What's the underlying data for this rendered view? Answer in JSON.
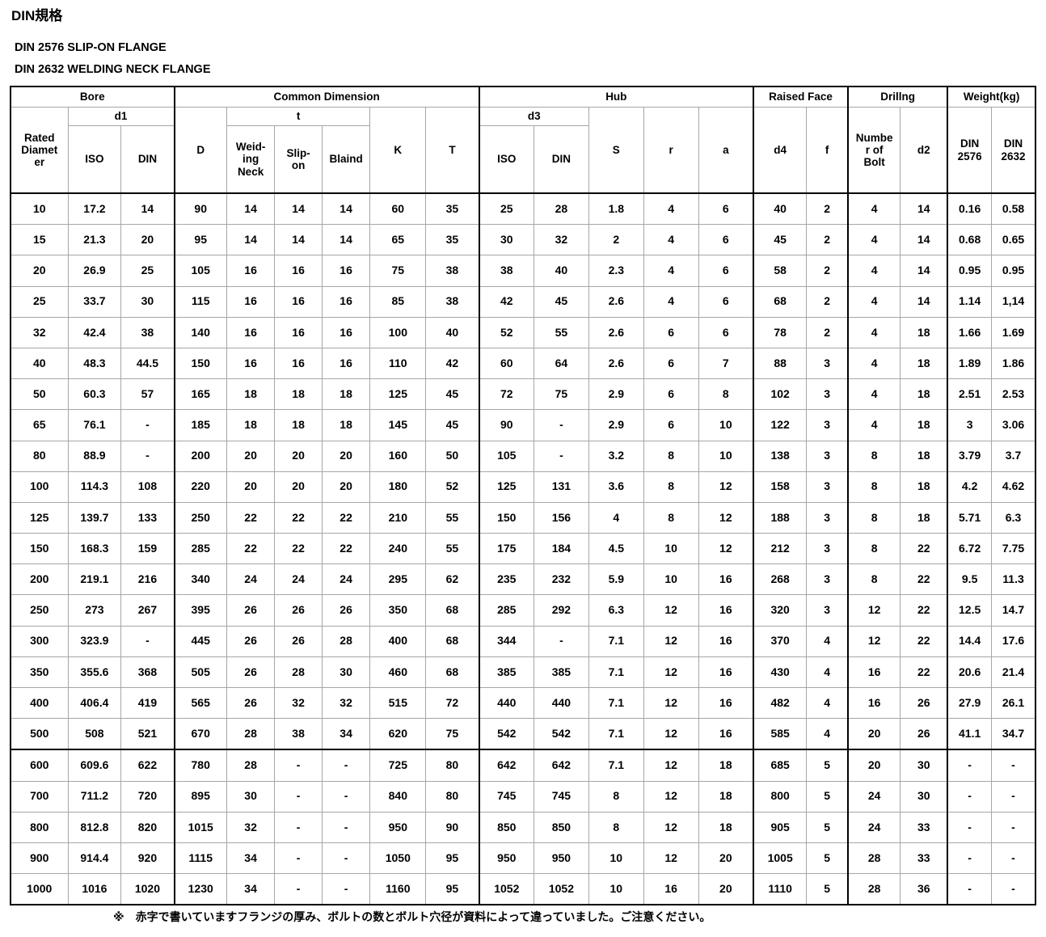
{
  "titles": {
    "main": "DIN規格",
    "sub1": "DIN 2576 SLIP-ON FLANGE",
    "sub2": "DIN 2632 WELDING NECK FLANGE"
  },
  "footnote": {
    "mark": "※",
    "text": "赤字で書いていますフランジの厚み、ボルトの数とボルト穴径が資料によって違っていました。ご注意ください。"
  },
  "colors": {
    "highlight": "#ff0000",
    "text": "#000000",
    "grid": "#a6a6a6",
    "frame": "#000000"
  },
  "table": {
    "groups": [
      {
        "label": "Bore",
        "span": 3
      },
      {
        "label": "Common Dimension",
        "span": 6
      },
      {
        "label": "Hub",
        "span": 5
      },
      {
        "label": "Raised Face",
        "span": 2
      },
      {
        "label": "Drillng",
        "span": 2
      },
      {
        "label": "Weight(kg)",
        "span": 2
      }
    ],
    "subgroups": {
      "d1": "d1",
      "t": "t",
      "d3": "d3"
    },
    "columns": [
      "Rated Diameter",
      "ISO",
      "DIN",
      "D",
      "Weid-ing Neck",
      "Slip-on",
      "Blaind",
      "K",
      "T",
      "ISO",
      "DIN",
      "S",
      "r",
      "a",
      "d4",
      "f",
      "Number of Bolt",
      "d2",
      "DIN 2576",
      "DIN 2632"
    ],
    "column_lines": {
      "rated_diameter": [
        "Rated",
        "Diamet",
        "er"
      ],
      "welding_neck": [
        "Weid-",
        "ing",
        "Neck"
      ],
      "slip_on": [
        "Slip-",
        "on"
      ],
      "number_of_bolt": [
        "Numbe",
        "r of",
        "Bolt"
      ],
      "din_2576": [
        "DIN",
        "2576"
      ],
      "din_2632": [
        "DIN",
        "2632"
      ]
    },
    "rows": [
      {
        "cells": [
          "10",
          "17.2",
          "14",
          "90",
          "14",
          "14",
          "14",
          "60",
          "35",
          "25",
          "28",
          "1.8",
          "4",
          "6",
          "40",
          "2",
          "4",
          "14",
          "0.16",
          "0.58"
        ],
        "red": []
      },
      {
        "cells": [
          "15",
          "21.3",
          "20",
          "95",
          "14",
          "14",
          "14",
          "65",
          "35",
          "30",
          "32",
          "2",
          "4",
          "6",
          "45",
          "2",
          "4",
          "14",
          "0.68",
          "0.65"
        ],
        "red": []
      },
      {
        "cells": [
          "20",
          "26.9",
          "25",
          "105",
          "16",
          "16",
          "16",
          "75",
          "38",
          "38",
          "40",
          "2.3",
          "4",
          "6",
          "58",
          "2",
          "4",
          "14",
          "0.95",
          "0.95"
        ],
        "red": []
      },
      {
        "cells": [
          "25",
          "33.7",
          "30",
          "115",
          "16",
          "16",
          "16",
          "85",
          "38",
          "42",
          "45",
          "2.6",
          "4",
          "6",
          "68",
          "2",
          "4",
          "14",
          "1.14",
          "1,14"
        ],
        "red": []
      },
      {
        "cells": [
          "32",
          "42.4",
          "38",
          "140",
          "16",
          "16",
          "16",
          "100",
          "40",
          "52",
          "55",
          "2.6",
          "6",
          "6",
          "78",
          "2",
          "4",
          "18",
          "1.66",
          "1.69"
        ],
        "red": []
      },
      {
        "cells": [
          "40",
          "48.3",
          "44.5",
          "150",
          "16",
          "16",
          "16",
          "110",
          "42",
          "60",
          "64",
          "2.6",
          "6",
          "7",
          "88",
          "3",
          "4",
          "18",
          "1.89",
          "1.86"
        ],
        "red": []
      },
      {
        "cells": [
          "50",
          "60.3",
          "57",
          "165",
          "18",
          "18",
          "18",
          "125",
          "45",
          "72",
          "75",
          "2.9",
          "6",
          "8",
          "102",
          "3",
          "4",
          "18",
          "2.51",
          "2.53"
        ],
        "red": []
      },
      {
        "cells": [
          "65",
          "76.1",
          "-",
          "185",
          "18",
          "18",
          "18",
          "145",
          "45",
          "90",
          "-",
          "2.9",
          "6",
          "10",
          "122",
          "3",
          "4",
          "18",
          "3",
          "3.06"
        ],
        "red": []
      },
      {
        "cells": [
          "80",
          "88.9",
          "-",
          "200",
          "20",
          "20",
          "20",
          "160",
          "50",
          "105",
          "-",
          "3.2",
          "8",
          "10",
          "138",
          "3",
          "8",
          "18",
          "3.79",
          "3.7"
        ],
        "red": [
          16
        ]
      },
      {
        "cells": [
          "100",
          "114.3",
          "108",
          "220",
          "20",
          "20",
          "20",
          "180",
          "52",
          "125",
          "131",
          "3.6",
          "8",
          "12",
          "158",
          "3",
          "8",
          "18",
          "4.2",
          "4.62"
        ],
        "red": []
      },
      {
        "cells": [
          "125",
          "139.7",
          "133",
          "250",
          "22",
          "22",
          "22",
          "210",
          "55",
          "150",
          "156",
          "4",
          "8",
          "12",
          "188",
          "3",
          "8",
          "18",
          "5.71",
          "6.3"
        ],
        "red": []
      },
      {
        "cells": [
          "150",
          "168.3",
          "159",
          "285",
          "22",
          "22",
          "22",
          "240",
          "55",
          "175",
          "184",
          "4.5",
          "10",
          "12",
          "212",
          "3",
          "8",
          "22",
          "6.72",
          "7.75"
        ],
        "red": [
          17
        ]
      },
      {
        "cells": [
          "200",
          "219.1",
          "216",
          "340",
          "24",
          "24",
          "24",
          "295",
          "62",
          "235",
          "232",
          "5.9",
          "10",
          "16",
          "268",
          "3",
          "8",
          "22",
          "9.5",
          "11.3"
        ],
        "red": [
          17
        ]
      },
      {
        "cells": [
          "250",
          "273",
          "267",
          "395",
          "26",
          "26",
          "26",
          "350",
          "68",
          "285",
          "292",
          "6.3",
          "12",
          "16",
          "320",
          "3",
          "12",
          "22",
          "12.5",
          "14.7"
        ],
        "red": [
          17
        ]
      },
      {
        "cells": [
          "300",
          "323.9",
          "-",
          "445",
          "26",
          "26",
          "28",
          "400",
          "68",
          "344",
          "-",
          "7.1",
          "12",
          "16",
          "370",
          "4",
          "12",
          "22",
          "14.4",
          "17.6"
        ],
        "red": [
          17
        ]
      },
      {
        "cells": [
          "350",
          "355.6",
          "368",
          "505",
          "26",
          "28",
          "30",
          "460",
          "68",
          "385",
          "385",
          "7.1",
          "12",
          "16",
          "430",
          "4",
          "16",
          "22",
          "20.6",
          "21.4"
        ],
        "red": [
          17
        ]
      },
      {
        "cells": [
          "400",
          "406.4",
          "419",
          "565",
          "26",
          "32",
          "32",
          "515",
          "72",
          "440",
          "440",
          "7.1",
          "12",
          "16",
          "482",
          "4",
          "16",
          "26",
          "27.9",
          "26.1"
        ],
        "red": [
          17
        ]
      },
      {
        "cells": [
          "500",
          "508",
          "521",
          "670",
          "28",
          "38",
          "34",
          "620",
          "75",
          "542",
          "542",
          "7.1",
          "12",
          "16",
          "585",
          "4",
          "20",
          "26",
          "41.1",
          "34.7"
        ],
        "red": [
          6,
          17
        ]
      },
      {
        "cells": [
          "600",
          "609.6",
          "622",
          "780",
          "28",
          "-",
          "-",
          "725",
          "80",
          "642",
          "642",
          "7.1",
          "12",
          "18",
          "685",
          "5",
          "20",
          "30",
          "-",
          "-"
        ],
        "red": []
      },
      {
        "cells": [
          "700",
          "711.2",
          "720",
          "895",
          "30",
          "-",
          "-",
          "840",
          "80",
          "745",
          "745",
          "8",
          "12",
          "18",
          "800",
          "5",
          "24",
          "30",
          "-",
          "-"
        ],
        "red": []
      },
      {
        "cells": [
          "800",
          "812.8",
          "820",
          "1015",
          "32",
          "-",
          "-",
          "950",
          "90",
          "850",
          "850",
          "8",
          "12",
          "18",
          "905",
          "5",
          "24",
          "33",
          "-",
          "-"
        ],
        "red": []
      },
      {
        "cells": [
          "900",
          "914.4",
          "920",
          "1115",
          "34",
          "-",
          "-",
          "1050",
          "95",
          "950",
          "950",
          "10",
          "12",
          "20",
          "1005",
          "5",
          "28",
          "33",
          "-",
          "-"
        ],
        "red": []
      },
      {
        "cells": [
          "1000",
          "1016",
          "1020",
          "1230",
          "34",
          "-",
          "-",
          "1160",
          "95",
          "1052",
          "1052",
          "10",
          "16",
          "20",
          "1110",
          "5",
          "28",
          "36",
          "-",
          "-"
        ],
        "red": []
      }
    ]
  }
}
